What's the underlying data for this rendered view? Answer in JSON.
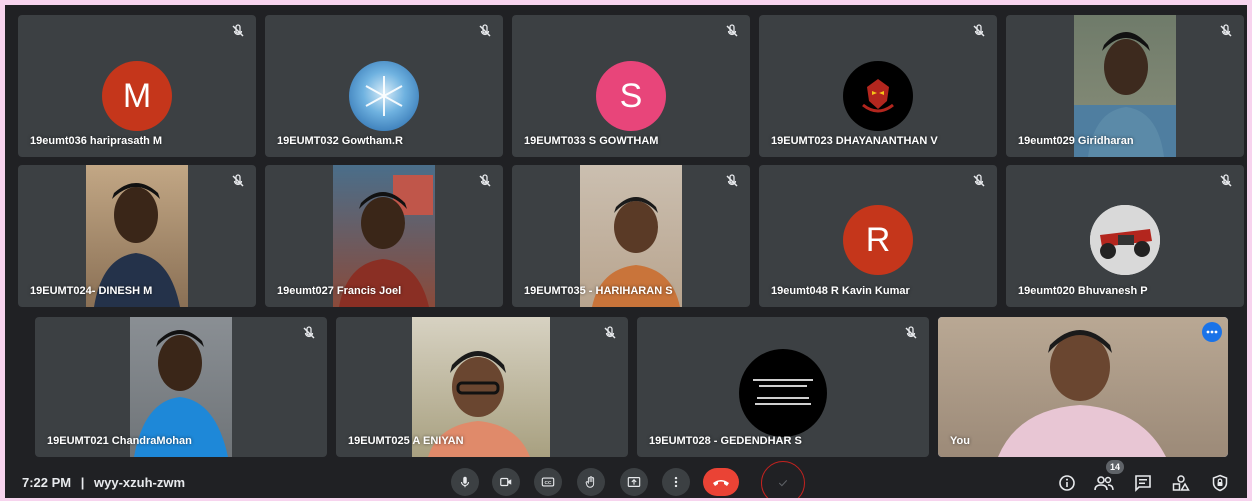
{
  "participants": [
    {
      "name": "19eumt036 hariprasath M",
      "avatar_letter": "M",
      "avatar_color": "#c5361b"
    },
    {
      "name": "19EUMT032 Gowtham.R"
    },
    {
      "name": "19EUMT033 S GOWTHAM",
      "avatar_letter": "S",
      "avatar_color": "#e8457a"
    },
    {
      "name": "19EUMT023 DHAYANANTHAN V"
    },
    {
      "name": "19eumt029 Giridharan"
    },
    {
      "name": "19EUMT024- DINESH M"
    },
    {
      "name": "19eumt027 Francis Joel"
    },
    {
      "name": "19EUMT035 - HARIHARAN S"
    },
    {
      "name": "19eumt048 R Kavin Kumar",
      "avatar_letter": "R",
      "avatar_color": "#c5361b"
    },
    {
      "name": "19eumt020 Bhuvanesh P"
    },
    {
      "name": "19EUMT021 ChandraMohan"
    },
    {
      "name": "19EUMT025 A ENIYAN"
    },
    {
      "name": "19EUMT028 - GEDENDHAR S"
    },
    {
      "name": "You"
    }
  ],
  "bottom_bar": {
    "time": "7:22 PM",
    "separator": "|",
    "meeting_code": "wyy-xzuh-zwm",
    "people_count": "14"
  },
  "colors": {
    "frame": "#f7d4ee",
    "background": "#202124",
    "tile": "#3c4043",
    "end_call": "#ea4335",
    "accent": "#1a73e8"
  },
  "icons": [
    "mic-off-icon",
    "microphone-icon",
    "camera-icon",
    "captions-icon",
    "raise-hand-icon",
    "present-screen-icon",
    "more-options-icon",
    "end-call-icon",
    "info-icon",
    "people-icon",
    "chat-icon",
    "activities-icon",
    "host-controls-icon"
  ]
}
